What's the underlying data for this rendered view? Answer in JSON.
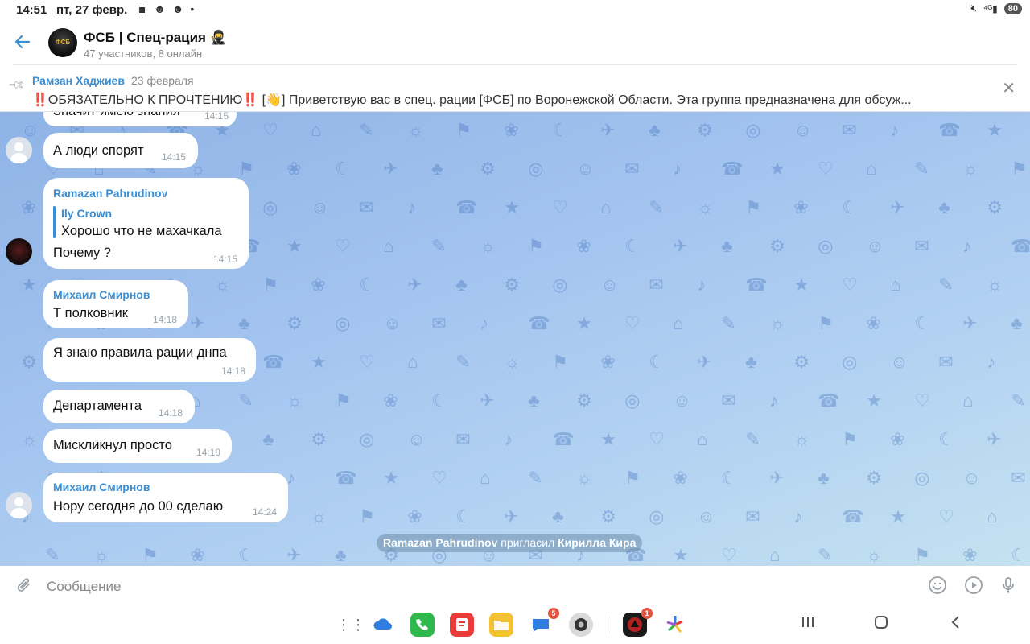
{
  "status_bar": {
    "time": "14:51",
    "date": "пт, 27 февр.",
    "battery": "80"
  },
  "header": {
    "title": "ФСБ | Спец-рация 🥷",
    "subtitle": "47 участников, 8 онлайн",
    "avatar_text": "ФСБ"
  },
  "pinned": {
    "author": "Рамзан Хаджиев",
    "date": "23 февраля",
    "text": "‼️ОБЯЗАТЕЛЬНО К ПРОЧТЕНИЮ‼️ [👋] Приветствую вас в спец. рации [ФСБ] по Воронежской Области. Эта группа предназначена для обсуж..."
  },
  "messages": [
    {
      "text": "Значит имею знания",
      "time": "14:15"
    },
    {
      "text": "А люди спорят",
      "time": "14:15"
    },
    {
      "author": "Ramazan Pahrudinov",
      "reply_author": "Ily Crown",
      "reply_text": "Хорошо что не махачкала",
      "text": "Почему ?",
      "time": "14:15"
    },
    {
      "author": "Михаил Смирнов",
      "text": "Т полковник",
      "time": "14:18"
    },
    {
      "text": "Я знаю правила рации днпа",
      "time": "14:18"
    },
    {
      "text": "Департамента",
      "time": "14:18"
    },
    {
      "text": "Мискликнул просто",
      "time": "14:18"
    },
    {
      "author": "Михаил Смирнов",
      "text": "Нору сегодня до 00 сделаю",
      "time": "14:24"
    }
  ],
  "service_message": {
    "actor": "Ramazan Pahrudinov",
    "action": "пригласил",
    "target": "Кирилла Кира"
  },
  "composer": {
    "placeholder": "Сообщение"
  },
  "taskbar": {
    "messages_badge": "5",
    "app_badge": "1"
  },
  "colors": {
    "accent": "#3a8ed4",
    "chat_bg_top": "#8fb3e6",
    "chat_bg_bottom": "#c4e2f0"
  }
}
